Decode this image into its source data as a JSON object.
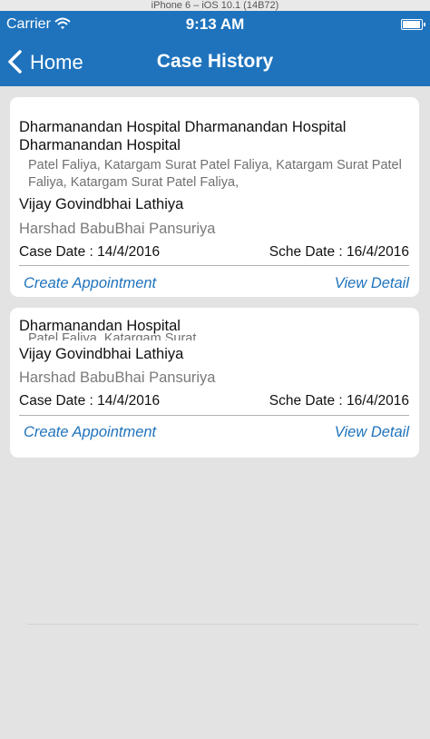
{
  "simulator": {
    "title": "iPhone 6 – iOS 10.1 (14B72)"
  },
  "status_bar": {
    "carrier": "Carrier",
    "time": "9:13 AM"
  },
  "nav": {
    "back_label": "Home",
    "title": "Case History"
  },
  "cases": [
    {
      "hospital": "Dharmanandan Hospital Dharmanandan Hospital Dharmanandan Hospital",
      "address": "Patel Faliya, Katargam Surat Patel Faliya, Katargam Surat Patel Faliya, Katargam Surat Patel Faliya,",
      "patient": "Vijay Govindbhai Lathiya",
      "doctor": "Harshad BabuBhai Pansuriya",
      "case_date": "Case Date : 14/4/2016",
      "sche_date": "Sche Date : 16/4/2016",
      "create_label": "Create Appointment",
      "view_label": "View Detail"
    },
    {
      "hospital": "Dharmanandan Hospital",
      "address": "Patel Faliya, Katargam Surat",
      "patient": "Vijay Govindbhai Lathiya",
      "doctor": "Harshad BabuBhai Pansuriya",
      "case_date": "Case Date : 14/4/2016",
      "sche_date": "Sche Date : 16/4/2016",
      "create_label": "Create Appointment",
      "view_label": "View Detail"
    }
  ],
  "colors": {
    "nav_bar": "#1f73bd",
    "link": "#1f73bd",
    "background": "#e3e3e3"
  },
  "icons": [
    "wifi-icon",
    "battery-icon",
    "back-chevron-icon"
  ]
}
